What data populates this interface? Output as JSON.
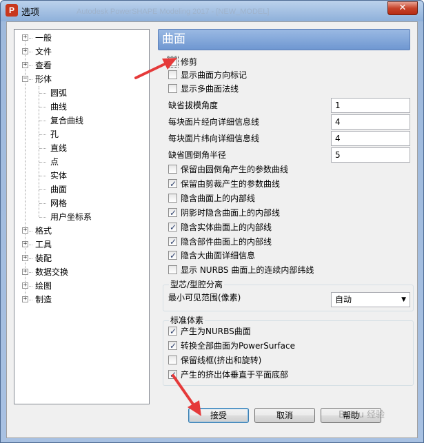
{
  "window": {
    "title": "选项",
    "app_icon_letter": "P",
    "background_title": "Autodesk PowerSHAPE Modeling 2017 - [NEW_MODEL]",
    "close_glyph": "✕"
  },
  "tree": {
    "items": [
      {
        "label": "一般",
        "expander": "+"
      },
      {
        "label": "文件",
        "expander": "+"
      },
      {
        "label": "查看",
        "expander": "+"
      },
      {
        "label": "形体",
        "expander": "−"
      },
      {
        "label": "圆弧"
      },
      {
        "label": "曲线"
      },
      {
        "label": "复合曲线"
      },
      {
        "label": "孔"
      },
      {
        "label": "直线"
      },
      {
        "label": "点"
      },
      {
        "label": "实体"
      },
      {
        "label": "曲面"
      },
      {
        "label": "网格"
      },
      {
        "label": "用户坐标系"
      },
      {
        "label": "格式",
        "expander": "+"
      },
      {
        "label": "工具",
        "expander": "+"
      },
      {
        "label": "装配",
        "expander": "+"
      },
      {
        "label": "数据交换",
        "expander": "+"
      },
      {
        "label": "绘图",
        "expander": "+"
      },
      {
        "label": "制造",
        "expander": "+"
      }
    ]
  },
  "panel": {
    "header": "曲面",
    "top_checkboxes": [
      {
        "label": "修剪",
        "checked": false
      },
      {
        "label": "显示曲面方向标记",
        "checked": false
      },
      {
        "label": "显示多曲面法线",
        "checked": false
      }
    ],
    "fields": [
      {
        "label": "缺省拔模角度",
        "value": "1"
      },
      {
        "label": "每块面片经向详细信息线",
        "value": "4"
      },
      {
        "label": "每块面片纬向详细信息线",
        "value": "4"
      },
      {
        "label": "缺省圆倒角半径",
        "value": "5"
      }
    ],
    "checkboxes": [
      {
        "label": "保留由圆倒角产生的参数曲线",
        "checked": false
      },
      {
        "label": "保留由剪裁产生的参数曲线",
        "checked": true
      },
      {
        "label": "隐含曲面上的内部线",
        "checked": false
      },
      {
        "label": "阴影时隐含曲面上的内部线",
        "checked": true
      },
      {
        "label": "隐含实体曲面上的内部线",
        "checked": true
      },
      {
        "label": "隐含部件曲面上的内部线",
        "checked": true
      },
      {
        "label": "隐含大曲面详细信息",
        "checked": true
      },
      {
        "label": "显示 NURBS 曲面上的连续内部纬线",
        "checked": false
      }
    ],
    "core_cavity": {
      "title": "型芯/型腔分离",
      "label": "最小可见范围(像素)",
      "selected": "自动",
      "arrow": "▼"
    },
    "primitives": {
      "title": "标准体素",
      "checkboxes": [
        {
          "label": "产生为NURBS曲面",
          "checked": true
        },
        {
          "label": "转换全部曲面为PowerSurface",
          "checked": true
        },
        {
          "label": "保留线框(挤出和旋转)",
          "checked": false
        },
        {
          "label": "产生的挤出体垂直于平面底部",
          "checked": true
        }
      ]
    }
  },
  "buttons": {
    "accept": "接受",
    "cancel": "取消",
    "help": "帮助"
  },
  "watermark": "Baidu 经验",
  "colors": {
    "header_blue": "#6f97d1",
    "annotation_red": "#e53a3a"
  }
}
